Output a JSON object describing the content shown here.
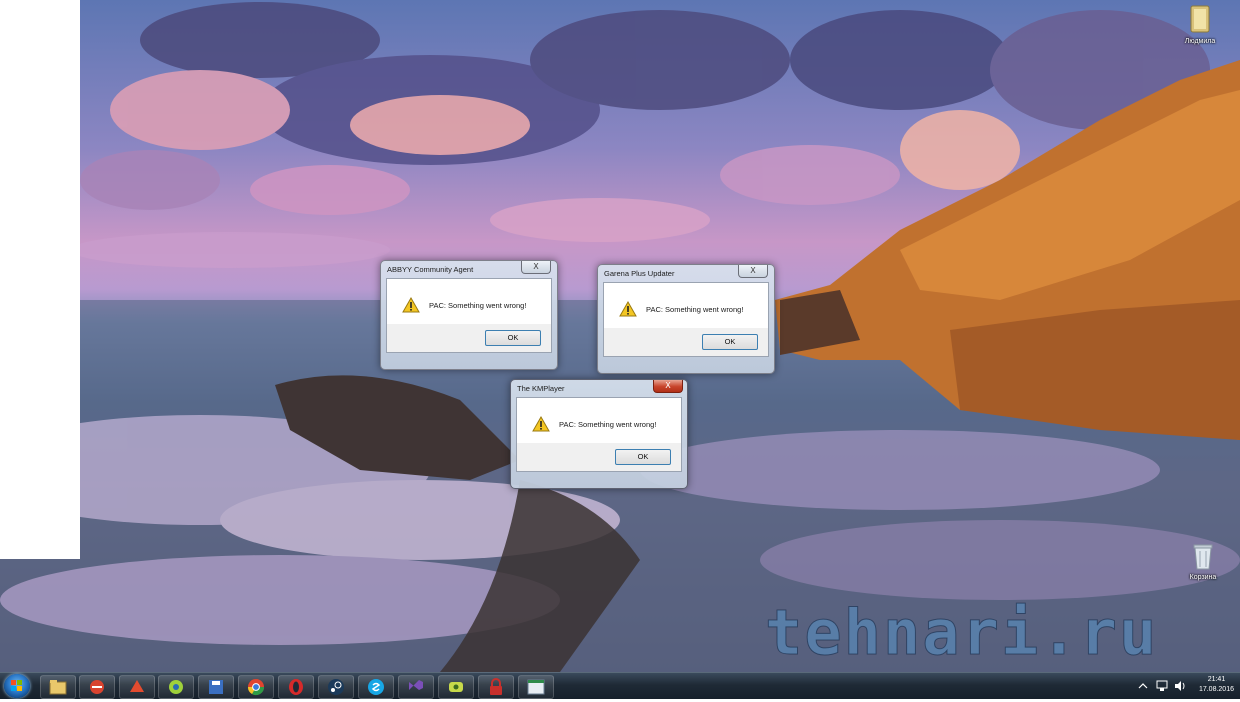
{
  "desktop": {
    "icons": [
      {
        "label": "Людмила",
        "icon": "folder-icon"
      },
      {
        "label": "Корзина",
        "icon": "recycle-bin-icon"
      }
    ],
    "watermark": "tehnari.ru"
  },
  "dialogs": [
    {
      "title": "ABBYY Community Agent",
      "message": "PAC: Something went wrong!",
      "ok_label": "OK",
      "close_label": "X"
    },
    {
      "title": "Garena Plus Updater",
      "message": "PAC: Something went wrong!",
      "ok_label": "OK",
      "close_label": "X"
    },
    {
      "title": "The KMPlayer",
      "message": "PAC: Something went wrong!",
      "ok_label": "OK",
      "close_label": "X"
    }
  ],
  "taskbar": {
    "pinned": [
      "explorer-icon",
      "game-icon",
      "game-icon",
      "game-icon",
      "save-icon",
      "chrome-icon",
      "opera-icon",
      "steam-icon",
      "skype-icon",
      "app-icon",
      "app-icon",
      "lock-icon",
      "window-icon"
    ],
    "clock_time": "21:41",
    "clock_date": "17.08.2016"
  }
}
